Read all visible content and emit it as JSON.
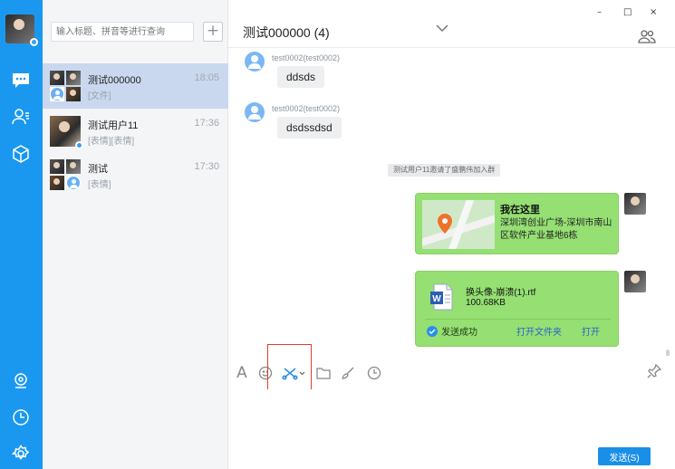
{
  "search": {
    "placeholder": "输入标题、拼音等进行查询"
  },
  "add_label": "+",
  "conversations": [
    {
      "name": "测试000000",
      "time": "18:05",
      "preview": "[文件]"
    },
    {
      "name": "测试用户11",
      "time": "17:36",
      "preview": "[表情][表情]"
    },
    {
      "name": "测试",
      "time": "17:30",
      "preview": "[表情]"
    }
  ],
  "chat": {
    "title": "测试000000 (4)",
    "window_controls": {
      "minimize": "–",
      "maximize": "□",
      "close": "×"
    },
    "messages": [
      {
        "sender": "test0002(test0002)",
        "text": "ddsds"
      },
      {
        "sender": "test0002(test0002)",
        "text": "dsdssdsd"
      }
    ],
    "system_message": "测试用户11邀请了盛鹏伟加入群",
    "location": {
      "title": "我在这里",
      "address": "深圳湾创业广场-深圳市南山区软件产业基地6栋"
    },
    "file": {
      "name": "换头像-崩溃(1).rtf",
      "size": "100.68KB",
      "status": "发送成功",
      "open_folder": "打开文件夹",
      "open": "打开"
    }
  },
  "toolbar": {
    "font_label": "A"
  },
  "send_label": "发送(S)",
  "colors": {
    "accent": "#1a98f0",
    "bubble_sent": "#95df73",
    "highlight": "#e23b2e"
  }
}
